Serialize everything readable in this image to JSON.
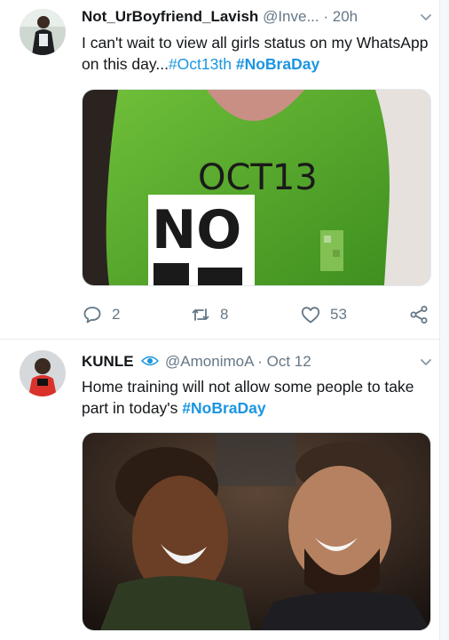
{
  "tweets": [
    {
      "display_name": "Not_UrBoyfriend_Lavish",
      "handle": "@Inve...",
      "separator": "·",
      "time": "20h",
      "text_plain": "I can't wait to view all girls status on my WhatsApp on this day...",
      "hashtag_1": "#Oct13th",
      "hashtag_2": "#NoBraDay",
      "media_text_date": "OCT13",
      "media_text_no": "NO",
      "replies": "2",
      "retweets": "8",
      "likes": "53"
    },
    {
      "display_name": "KUNLE",
      "handle": "@AmonimoA",
      "separator": "·",
      "time": "Oct 12",
      "text_plain": "Home training will not allow some people to take part in today's ",
      "hashtag_1": "#NoBraDay"
    }
  ],
  "colors": {
    "link": "#1b95e0",
    "meta": "#657786",
    "text": "#14171a"
  },
  "icons": [
    "chevron-down-icon",
    "reply-icon",
    "retweet-icon",
    "like-icon",
    "share-icon",
    "eye-icon"
  ]
}
